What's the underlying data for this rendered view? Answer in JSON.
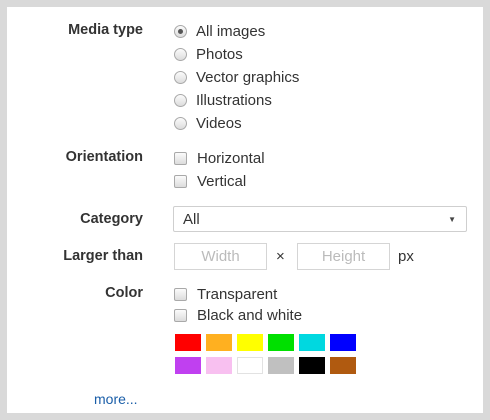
{
  "media_type": {
    "label": "Media type",
    "options": [
      "All images",
      "Photos",
      "Vector graphics",
      "Illustrations",
      "Videos"
    ],
    "selected": "All images"
  },
  "orientation": {
    "label": "Orientation",
    "options": [
      "Horizontal",
      "Vertical"
    ]
  },
  "category": {
    "label": "Category",
    "value": "All",
    "arrow": "▼"
  },
  "larger_than": {
    "label": "Larger than",
    "width_placeholder": "Width",
    "times": "×",
    "height_placeholder": "Height",
    "unit": "px"
  },
  "color": {
    "label": "Color",
    "options": [
      "Transparent",
      "Black and white"
    ],
    "swatches_row1": [
      "#ff0000",
      "#ffb020",
      "#ffff00",
      "#00e000",
      "#00d8e0",
      "#0000ff"
    ],
    "swatches_row2": [
      "#c040f0",
      "#f8c0f0",
      "#ffffff",
      "#c0c0c0",
      "#000000",
      "#b05a10"
    ]
  },
  "more_link": "more..."
}
